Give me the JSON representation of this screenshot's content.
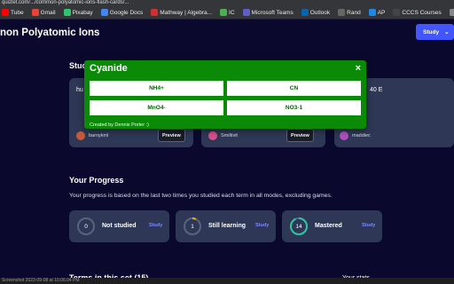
{
  "browser": {
    "url": "quizlet.com/.../common-polyatomic-ions-flash-cards/...",
    "bookmarks": [
      {
        "label": "Tube",
        "icon": "youtube-icon",
        "color": "#ff0000"
      },
      {
        "label": "Gmail",
        "icon": "gmail-icon",
        "color": "#ea4335"
      },
      {
        "label": "Pixabay",
        "icon": "pixabay-icon",
        "color": "#2ec66d"
      },
      {
        "label": "Google Docs",
        "icon": "docs-icon",
        "color": "#4285f4"
      },
      {
        "label": "Mathway | Algebra...",
        "icon": "mathway-icon",
        "color": "#d32f2f"
      },
      {
        "label": "IC",
        "icon": "ic-icon",
        "color": "#4caf50"
      },
      {
        "label": "Microsoft Teams",
        "icon": "teams-icon",
        "color": "#5b5fc7"
      },
      {
        "label": "Outlook",
        "icon": "outlook-icon",
        "color": "#0a64ad"
      },
      {
        "label": "Rand",
        "icon": "rand-icon",
        "color": "#666666"
      },
      {
        "label": "AP",
        "icon": "ap-icon",
        "color": "#1e88e5"
      },
      {
        "label": "CCCS Courses",
        "icon": "cccs-icon",
        "color": "#444444"
      },
      {
        "label": "Z-Lib",
        "icon": "zlib-icon",
        "color": "#888888"
      }
    ]
  },
  "page": {
    "title": "non Polyatomic Ions",
    "study_button": "Study",
    "students_heading": "Stud"
  },
  "cards": [
    {
      "title": "hu",
      "user": "barnykml",
      "avatar_color": "#c45a3a",
      "preview": "Preview"
    },
    {
      "title": "",
      "user": "Smiltivit",
      "avatar_color": "#d6508a",
      "preview": "Preview"
    },
    {
      "title": "40 E",
      "user": "maddiec",
      "avatar_color": "#b04fbf",
      "preview": ""
    }
  ],
  "modal": {
    "title": "Cyanide",
    "close": "×",
    "options": [
      "NH4+",
      "CN",
      "MnO4-",
      "NO3-1"
    ],
    "credit": "Created by Dennis Porter :)"
  },
  "progress": {
    "heading": "Your Progress",
    "description": "Your progress is based on the last two times you studied each term in all modes, excluding games.",
    "items": [
      {
        "count": "0",
        "label": "Not studied",
        "study": "Study",
        "ring_color": "#586380",
        "fill": 0
      },
      {
        "count": "1",
        "label": "Still learning",
        "study": "Study",
        "ring_color": "#f5a623",
        "fill": 0.07
      },
      {
        "count": "14",
        "label": "Mastered",
        "study": "Study",
        "ring_color": "#2ec4a0",
        "fill": 0.93
      }
    ]
  },
  "terms": {
    "heading": "Terms in this set (15)",
    "stats": "Your stats"
  },
  "taskbar": {
    "text": "Screenshot 2023-09-08 at 10.06.04 PM"
  }
}
